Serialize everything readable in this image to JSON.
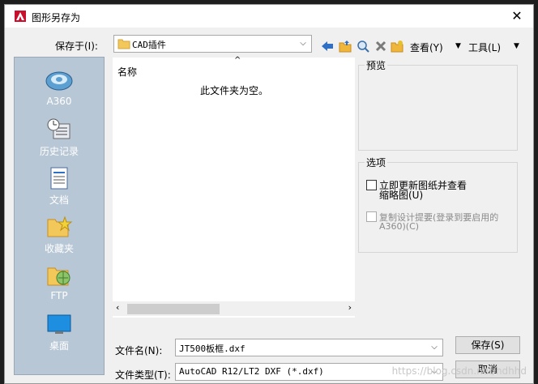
{
  "window": {
    "title": "图形另存为"
  },
  "save_in": {
    "label": "保存于(I):",
    "value": "CAD插件"
  },
  "toolbar": {
    "view_label": "查看(Y)",
    "tools_label": "工具(L)"
  },
  "places": [
    {
      "label": "A360",
      "icon": "a360-icon"
    },
    {
      "label": "历史记录",
      "icon": "history-icon"
    },
    {
      "label": "文档",
      "icon": "documents-icon"
    },
    {
      "label": "收藏夹",
      "icon": "favorites-icon"
    },
    {
      "label": "FTP",
      "icon": "ftp-icon"
    },
    {
      "label": "桌面",
      "icon": "desktop-icon"
    }
  ],
  "filelist": {
    "column_name": "名称",
    "empty_message": "此文件夹为空。"
  },
  "preview": {
    "label": "预览"
  },
  "options": {
    "label": "选项",
    "update_thumbnail_line1": "立即更新图纸并查看",
    "update_thumbnail_line2": "缩略图(U)",
    "copy_design_line1": "复制设计提要(登录到要启用的",
    "copy_design_line2": "A360)(C)"
  },
  "filename": {
    "label": "文件名(N):",
    "value": "JT500板框.dxf"
  },
  "filetype": {
    "label": "文件类型(T):",
    "value": "AutoCAD R12/LT2 DXF (*.dxf)"
  },
  "buttons": {
    "save": "保存(S)",
    "cancel": "取消"
  },
  "watermark": "https://blog.csdn.net/hdhhd"
}
